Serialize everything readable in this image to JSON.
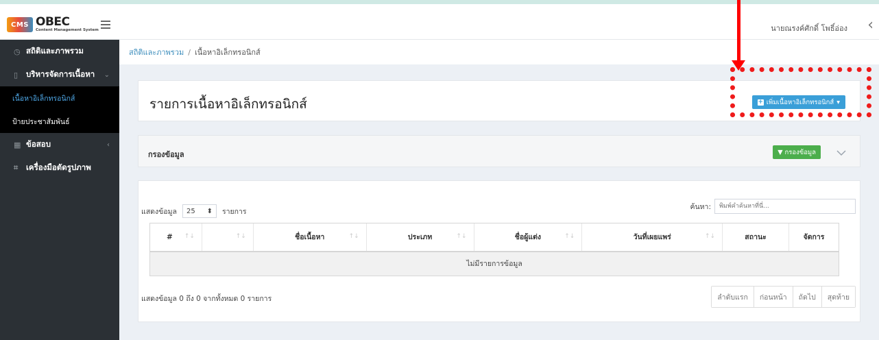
{
  "header": {
    "brand_badge": "CMS",
    "brand_name": "OBEC",
    "brand_subtitle": "Content Management System",
    "user_name": "นายณรงค์ศักดิ์ โพธิ์อ่อง",
    "back_icon": "chevron-left-icon",
    "menu_icon": "hamburger-icon"
  },
  "sidebar": {
    "items": [
      {
        "label": "สถิติและภาพรวม",
        "icon": "dashboard-icon"
      },
      {
        "label": "บริหารจัดการเนื้อหา",
        "icon": "file-icon",
        "caret": "⌄"
      },
      {
        "label": "เนื้อหาอิเล็กทรอนิกส์",
        "active": true
      },
      {
        "label": "ป้ายประชาสัมพันธ์"
      },
      {
        "label": "ข้อสอบ",
        "icon": "grid-icon",
        "caret": "‹"
      },
      {
        "label": "เครื่องมือตัดรูปภาพ",
        "icon": "crop-icon"
      }
    ]
  },
  "breadcrumb": {
    "home": "สถิติและภาพรวม",
    "separator": "/",
    "current": "เนื้อหาอิเล็กทรอนิกส์"
  },
  "page": {
    "title": "รายการเนื้อหาอิเล็กทรอนิกส์",
    "add_button": "เพิ่มเนื้อหาอิเล็กทรอนิกส์"
  },
  "filter": {
    "title": "กรองข้อมูล",
    "button": "กรองข้อมูล"
  },
  "table": {
    "show_label": "แสดงข้อมูล",
    "page_size": "25",
    "items_label": "รายการ",
    "search_label": "ค้นหา:",
    "search_placeholder": "พิมพ์คำค้นหาที่นี่...",
    "columns": [
      "#",
      "",
      "ชื่อเนื้อหา",
      "ประเภท",
      "ชื่อผู้แต่ง",
      "วันที่เผยแพร่",
      "สถานะ",
      "จัดการ"
    ],
    "empty_message": "ไม่มีรายการข้อมูล",
    "info": "แสดงข้อมูล 0 ถึง 0 จากทั้งหมด 0 รายการ",
    "pagination": [
      "ลำดับแรก",
      "ก่อนหน้า",
      "ถัดไป",
      "สุดท้าย"
    ]
  },
  "colors": {
    "sidebar_bg": "#2b3035",
    "primary": "#3a9fd8",
    "success": "#4cae4c",
    "annotation": "#ef1b1b"
  }
}
